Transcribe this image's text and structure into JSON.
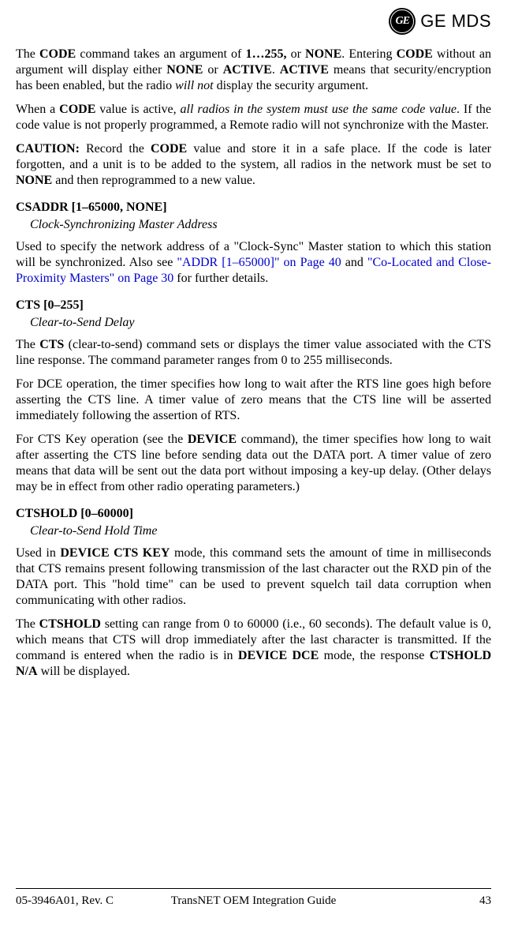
{
  "header": {
    "brand_logo_text": "GE",
    "brand_text": "GE MDS"
  },
  "para1": {
    "t1": "The ",
    "code1": "CODE",
    "t2": " command takes an argument of ",
    "bold1": "1…255,",
    "t3": " or ",
    "code2": "NONE",
    "t4": ". Entering ",
    "code3": "CODE",
    "t5": " without an argument will display either ",
    "code4": "NONE",
    "t6": " or ",
    "code5": "ACTIVE",
    "t7": ". ",
    "code6": "ACTIVE",
    "t8": " means that security/encryption has been enabled, but the radio ",
    "italic1": "will not",
    "t9": " display the security argument."
  },
  "para2": {
    "t1": "When a ",
    "code1": "CODE",
    "t2": " value is active, ",
    "italic1": "all radios in the system must use the same code value",
    "t3": ". If the code value is not properly programmed, a Remote radio will not synchronize with the Master."
  },
  "para3": {
    "bold1": "CAUTION:",
    "t1": " Record the ",
    "code1": "CODE",
    "t2": " value and store it in a safe place. If the code is later forgotten, and a unit is to be added to the system, all radios in the network must be set to ",
    "code2": "NONE",
    "t3": " and then reprogrammed to a new value."
  },
  "csaddr": {
    "heading": "CSADDR [1–65000, NONE]",
    "subtitle": "Clock-Synchronizing Master Address",
    "p1_t1": "Used to specify the network address of a \"Clock-Sync\" Master station to which this station will be synchronized. Also see ",
    "p1_link1": "\"ADDR [1–65000]\" on Page 40",
    "p1_t2": " and ",
    "p1_link2": "\"Co-Located and Close-Proximity Masters\" on Page 30",
    "p1_t3": " for further details."
  },
  "cts": {
    "heading": "CTS [0–255]",
    "subtitle": "Clear-to-Send Delay",
    "p1_t1": "The ",
    "p1_code1": "CTS",
    "p1_t2": " (clear-to-send) command sets or displays the timer value associated with the CTS line response. The command parameter ranges from 0 to 255 milliseconds.",
    "p2": "For DCE operation, the timer specifies how long to wait after the RTS line goes high before asserting the CTS line. A timer value of zero means that the CTS line will be asserted immediately following the assertion of RTS.",
    "p3_t1": "For CTS Key operation (see the ",
    "p3_code1": "DEVICE",
    "p3_t2": " command), the timer specifies how long to wait after asserting the CTS line before sending data out the ",
    "p3_sc1": "DATA",
    "p3_t3": " port. A timer value of zero means that data will be sent out the data port without imposing a key-up delay. (Other delays may be in effect from other radio operating parameters.)"
  },
  "ctshold": {
    "heading": "CTSHOLD [0–60000]",
    "subtitle": "Clear-to-Send Hold Time",
    "p1_t1": "Used in ",
    "p1_code1": "DEVICE CTS KEY",
    "p1_t2": " mode, this command sets the amount of time in milliseconds that CTS remains present following transmission of the last character out the RXD pin of the ",
    "p1_sc1": "DATA",
    "p1_t3": " port. This \"hold time\" can be used to prevent squelch tail data corruption when communicating with other radios.",
    "p2_t1": "The ",
    "p2_code1": "CTSHOLD",
    "p2_t2": " setting can range from 0 to 60000 (i.e., 60 seconds). The default value is 0, which means that CTS will drop immediately after the last character is transmitted. If the command is entered when the radio is in ",
    "p2_code2": "DEVICE DCE",
    "p2_t3": " mode, the response ",
    "p2_code3": "CTSHOLD N/A",
    "p2_t4": " will be displayed."
  },
  "footer": {
    "left": "05-3946A01, Rev. C",
    "center": "TransNET OEM Integration Guide",
    "right": "43"
  }
}
